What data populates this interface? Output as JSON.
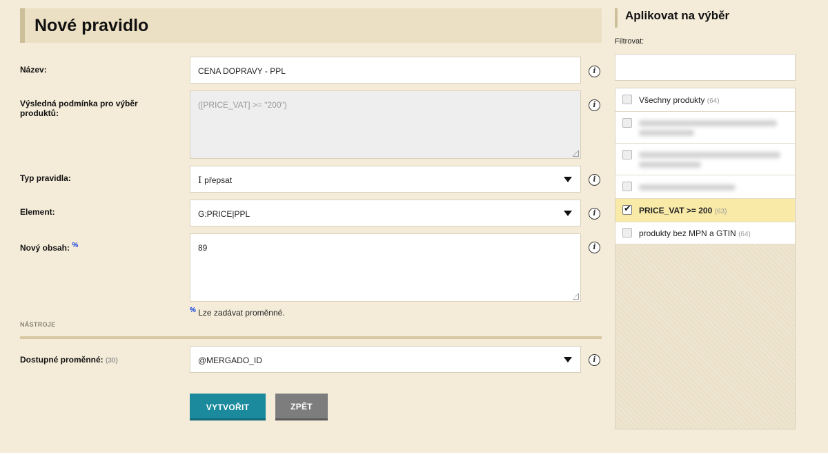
{
  "page": {
    "title": "Nové pravidlo"
  },
  "form": {
    "name": {
      "label": "Název:",
      "value": "CENA DOPRAVY - PPL"
    },
    "condition": {
      "label": "Výsledná podmínka pro výběr produktů:",
      "value": "([PRICE_VAT] >= \"200\")"
    },
    "rule_type": {
      "label": "Typ pravidla:",
      "value": "přepsat",
      "icon": "text-cursor-icon"
    },
    "element": {
      "label": "Element:",
      "value": "G:PRICE|PPL"
    },
    "new_content": {
      "label": "Nový obsah:",
      "label_marker": "%",
      "value": "89"
    },
    "hint": {
      "marker": "%",
      "text": "Lze zadávat proměnné."
    },
    "tools_section": "NÁSTROJE",
    "variables": {
      "label": "Dostupné proměnné:",
      "count": "(30)",
      "value": "@MERGADO_ID"
    },
    "buttons": {
      "create": "VYTVOŘIT",
      "back": "ZPĚT"
    }
  },
  "sidebar": {
    "title": "Aplikovat na výběr",
    "filter_label": "Filtrovat:",
    "filter_value": "",
    "items": [
      {
        "name": "Všechny produkty",
        "count": "(64)",
        "checked": false
      },
      {
        "name": "",
        "count": "",
        "checked": false
      },
      {
        "name": "",
        "count": "",
        "checked": false
      },
      {
        "name": "",
        "count": "",
        "checked": false
      },
      {
        "name": "PRICE_VAT >= 200",
        "count": "(63)",
        "checked": true
      },
      {
        "name": "produkty bez MPN a GTIN",
        "count": "(64)",
        "checked": false
      }
    ]
  },
  "colors": {
    "background": "#f4ecd9",
    "primary_button": "#1b8a9d",
    "secondary_button": "#7d7d7d",
    "selected_item": "#f9eaa8"
  }
}
